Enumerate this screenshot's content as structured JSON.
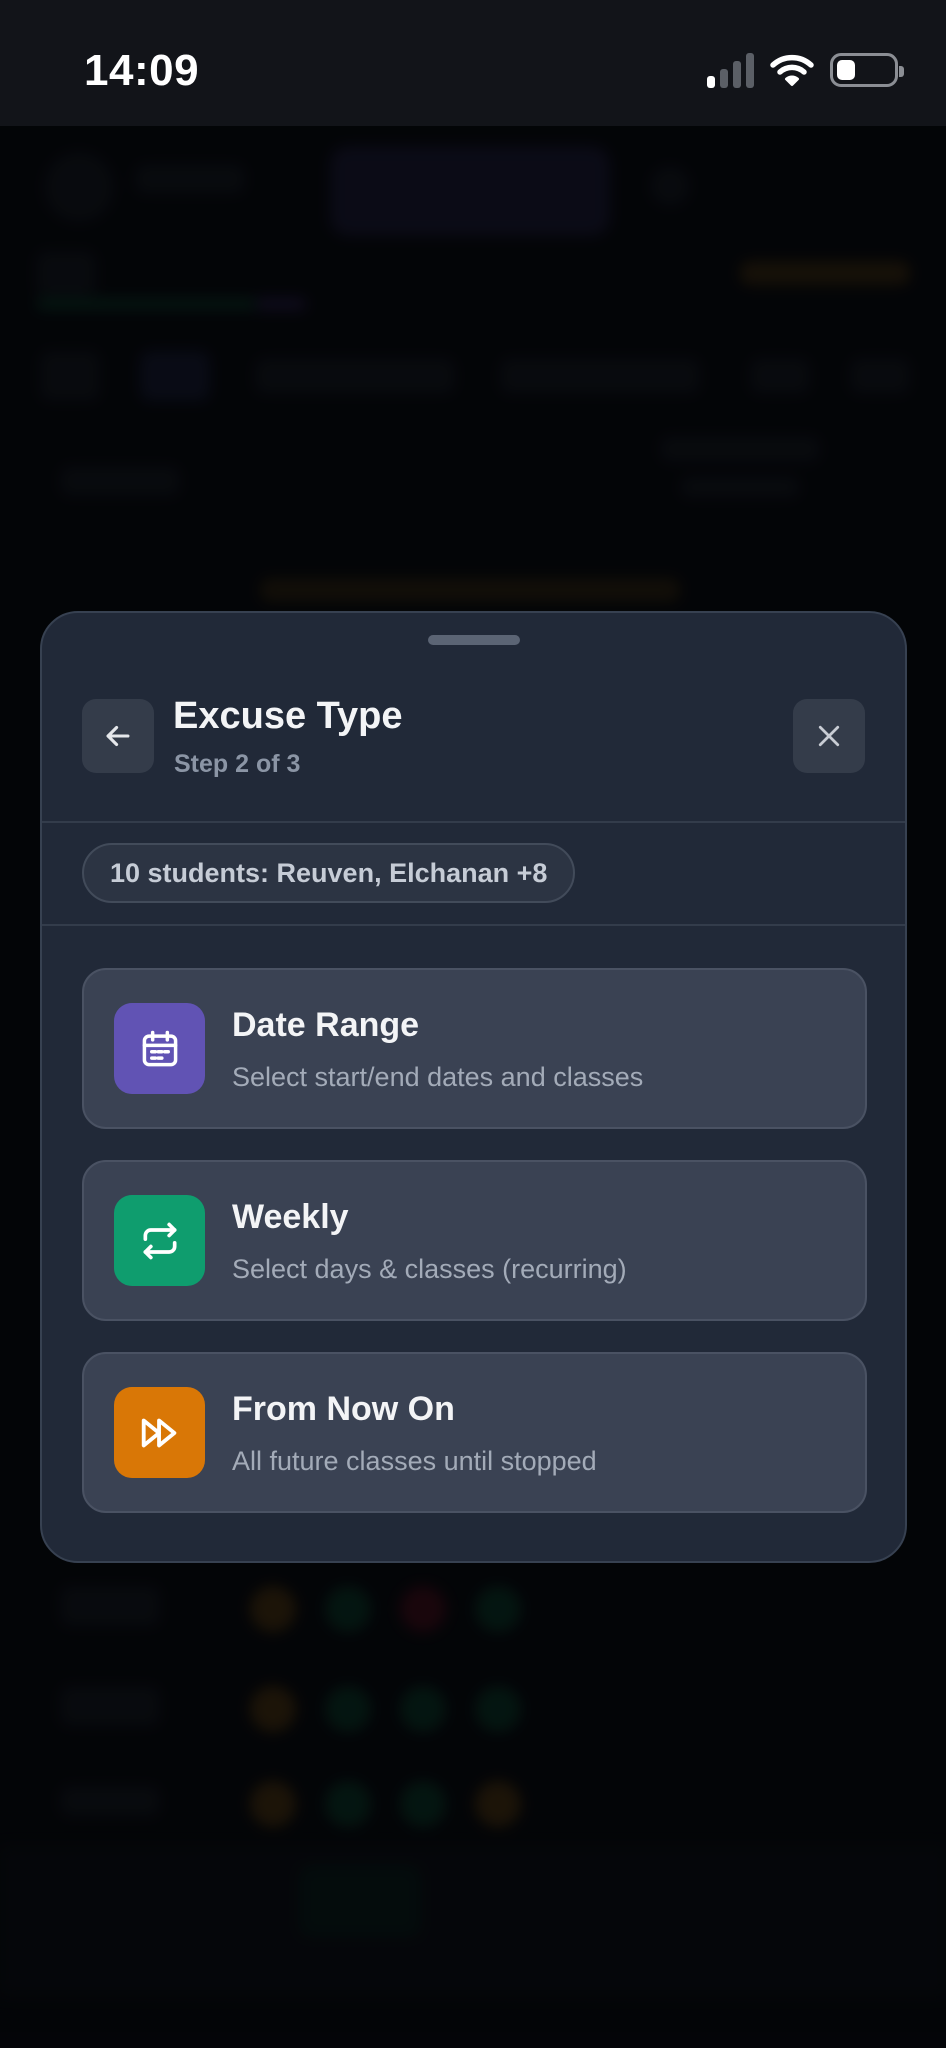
{
  "status_bar": {
    "time": "14:09"
  },
  "sheet": {
    "title": "Excuse Type",
    "step": "Step 2 of 3",
    "back_icon": "arrow-left-icon",
    "close_icon": "close-icon",
    "students_chip": "10 students: Reuven, Elchanan +8"
  },
  "options": [
    {
      "title": "Date Range",
      "subtitle": "Select start/end dates and classes",
      "icon": "calendar-icon",
      "color": "#6153b4"
    },
    {
      "title": "Weekly",
      "subtitle": "Select days & classes (recurring)",
      "icon": "repeat-icon",
      "color": "#0f9d6e"
    },
    {
      "title": "From Now On",
      "subtitle": "All future classes until stopped",
      "icon": "fast-forward-icon",
      "color": "#d97706"
    }
  ],
  "colors": {
    "sheet_background": "#212938",
    "card_background": "#3a4253",
    "title_text": "#f3f4f6",
    "muted_text": "#8b95a5"
  }
}
